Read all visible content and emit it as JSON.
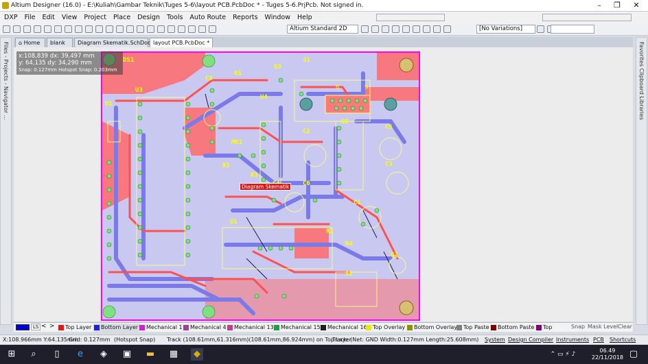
{
  "titlebar": {
    "title": "Altium Designer (16.0) - E:\\Kuliah\\Gambar Teknik\\Tuges 5-6\\layout PCB.PcbDoc * - Tuges 5-6.PrjPcb. Not signed in.",
    "minimize": "–",
    "restore": "❐",
    "close": "✕"
  },
  "menu": {
    "items": [
      "DXP",
      "File",
      "Edit",
      "View",
      "Project",
      "Place",
      "Design",
      "Tools",
      "Auto Route",
      "Reports",
      "Window",
      "Help"
    ]
  },
  "toolbar": {
    "view_combo": "Altium Standard 2D",
    "variations_combo": "[No Variations]"
  },
  "tabs": [
    {
      "label": "Home"
    },
    {
      "label": "blank"
    },
    {
      "label": "Diagram Skematik.SchDoc"
    },
    {
      "label": "layout PCB.PcbDoc *"
    }
  ],
  "left_panel": {
    "label": "Files - Projects - Navigator ..."
  },
  "right_panel": {
    "label": "Favorites  Clipboard  Libraries"
  },
  "coords": {
    "line1": "x:108,839   dx: 39,497 mm",
    "line2": "y: 64,135    dy: 34,290 mm",
    "line3": "Snap: 0.127mm Hotspot Snap: 0.203mm"
  },
  "designators": {
    "ds1": "DS1",
    "u3": "U3",
    "d1": "D1",
    "c8": "C8",
    "r5": "R5",
    "d3": "D3",
    "j1": "J1",
    "u4": "U4",
    "c2": "C2",
    "u2": "U2",
    "c5": "C5",
    "mk1": "MK1",
    "c3": "C3",
    "r1": "R1",
    "r3": "R3",
    "c4": "C4",
    "c6": "C6",
    "c1": "C1",
    "u1": "U1",
    "r2": "R2",
    "r4": "R4",
    "q2": "Q2",
    "s1": "S1",
    "pin6": "6",
    "pin9": "9"
  },
  "hint": "Diagram Skematik",
  "layers": [
    {
      "name": "Top Layer",
      "color": "#e01818"
    },
    {
      "name": "Bottom Layer",
      "color": "#2020d8"
    },
    {
      "name": "Mechanical 1",
      "color": "#d020d0"
    },
    {
      "name": "Mechanical 4",
      "color": "#a040a0"
    },
    {
      "name": "Mechanical 13",
      "color": "#c04090"
    },
    {
      "name": "Mechanical 15",
      "color": "#20a040"
    },
    {
      "name": "Mechanical 16",
      "color": "#202020"
    },
    {
      "name": "Top Overlay",
      "color": "#e8e800"
    },
    {
      "name": "Bottom Overlay",
      "color": "#909000"
    },
    {
      "name": "Top Paste",
      "color": "#808080"
    },
    {
      "name": "Bottom Paste",
      "color": "#800000"
    },
    {
      "name": "Top",
      "color": "#800080"
    }
  ],
  "layer_right": {
    "snap": "Snap",
    "mask": "Mask Level",
    "clear": "Clear",
    "ls": "LS"
  },
  "status": {
    "xy": "X:108.966mm Y:64.135mm",
    "grid": "Grid: 0.127mm",
    "hotspot": "(Hotspot Snap)",
    "track": "Track (108.61mm,61.316mm)(108.61mm,86.924mm) on Top Layer",
    "net": "Track: (Net: GND Width:0.127mm Length:25.608mm)",
    "links": [
      "System",
      "Design Compiler",
      "Instruments",
      "PCB",
      "Shortcuts"
    ]
  },
  "clock": {
    "time": "06.49",
    "date": "22/11/2018"
  },
  "colors": {
    "board": "#c8c8f0",
    "top": "#ff6a6a",
    "bottom": "#7a7ae8",
    "overlay": "#ffff00",
    "pad": "#7fe07f"
  }
}
